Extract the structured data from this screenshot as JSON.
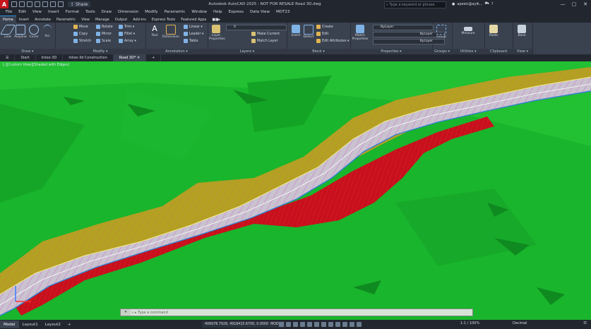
{
  "window": {
    "app_letter": "A",
    "title": "Autodesk AutoCAD 2025 - NOT FOR RESALE   Road 3D.dwg",
    "share_label": "Share",
    "search_placeholder": "Type a keyword or phrase",
    "user": "apesic@aylk...",
    "controls": [
      "—",
      "▢",
      "✕"
    ]
  },
  "menu": [
    "File",
    "Edit",
    "View",
    "Insert",
    "Format",
    "Tools",
    "Draw",
    "Dimension",
    "Modify",
    "Parametric",
    "Window",
    "Help",
    "Express",
    "Data View",
    "MDT23"
  ],
  "ribbon_tabs": [
    "Home",
    "Insert",
    "Annotate",
    "Parametric",
    "View",
    "Manage",
    "Output",
    "Add-ins",
    "Express Tools",
    "Featured Apps",
    "■■▸"
  ],
  "ribbon_active_tab": "Home",
  "ribbon": {
    "draw": {
      "title": "Draw ▾",
      "line": "Line",
      "polyline": "Polyline",
      "circle": "Circle",
      "arc": "Arc"
    },
    "modify": {
      "title": "Modify ▾",
      "move": "Move",
      "rotate": "Rotate",
      "trim": "Trim ▾",
      "copy": "Copy",
      "mirror": "Mirror",
      "fillet": "Fillet ▾",
      "stretch": "Stretch",
      "scale": "Scale",
      "array": "Array ▾"
    },
    "annotation": {
      "title": "Annotation ▾",
      "text": "Text",
      "dimension": "Dimension",
      "linear": "Linear ▾",
      "leader": "Leader ▾",
      "table": "Table"
    },
    "layers": {
      "title": "Layers ▾",
      "properties": "Layer Properties",
      "current_layer": "0",
      "make_current": "Make Current",
      "match_layer": "Match Layer"
    },
    "block": {
      "title": "Block ▾",
      "insert": "Insert",
      "detect": "Detect",
      "create": "Create",
      "edit": "Edit",
      "edit_attributes": "Edit Attributes ▾"
    },
    "properties": {
      "title": "Properties ▾",
      "match": "Match Properties",
      "color": "ByLayer",
      "linetype": "ByLayer",
      "lineweight": "ByLayer"
    },
    "groups": {
      "title": "Groups ▾",
      "group": "Group"
    },
    "utilities": {
      "title": "Utilities ▾",
      "measure": "Measure"
    },
    "clipboard": {
      "title": "Clipboard",
      "paste": "Paste"
    },
    "view": {
      "title": "View ▾",
      "base": "Base"
    }
  },
  "doc_tabs": [
    "Start",
    "Intoo-3D",
    "Intoo-3d Construction",
    "Road 3D*"
  ],
  "doc_active": "Road 3D*",
  "viewport_label": "[-][Custom View][Shaded with Edges]",
  "command_placeholder": "Type a command",
  "status": {
    "tabs": [
      "Model",
      "Layout1",
      "Layout2"
    ],
    "active": "Model",
    "coords": "406978.7929, 4918415.6700, 0.0000",
    "mode": "MODEL",
    "scale": "1:1 / 100%",
    "units": "Decimal"
  },
  "colors": {
    "terrain": "#19b52c",
    "cut_slope": "#c8101c",
    "fill_slope": "#b4a021",
    "road_surface": "#c9c2cf",
    "road_lines": "#d44fd0"
  }
}
